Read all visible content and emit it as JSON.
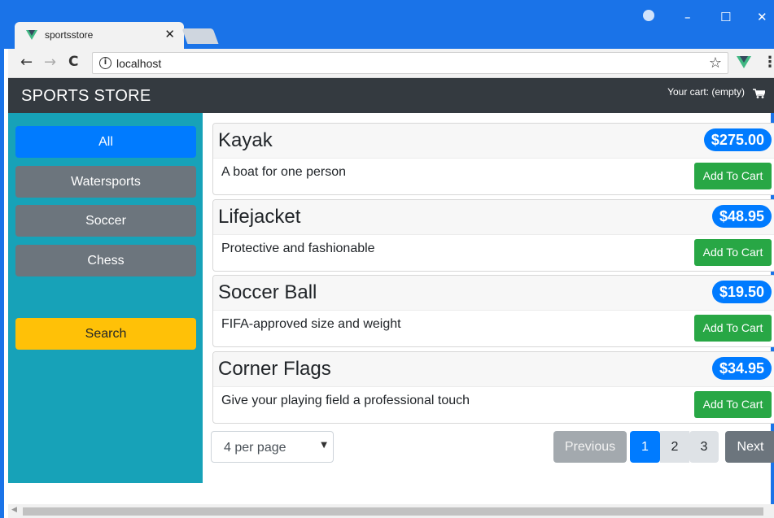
{
  "browser": {
    "tab_title": "sportsstore",
    "tab_close": "✕",
    "url": "localhost",
    "info_glyph": "i",
    "back_glyph": "←",
    "forward_glyph": "→",
    "reload_glyph": "C",
    "star_glyph": "☆",
    "menu_glyph": "⋮",
    "minimize_glyph": "–",
    "maximize_glyph": "☐",
    "close_glyph": "✕"
  },
  "app": {
    "brand": "SPORTS STORE",
    "cart_text": "Your cart: (empty)"
  },
  "sidebar": {
    "categories": [
      {
        "label": "All",
        "active": true
      },
      {
        "label": "Watersports",
        "active": false
      },
      {
        "label": "Soccer",
        "active": false
      },
      {
        "label": "Chess",
        "active": false
      }
    ],
    "search_label": "Search"
  },
  "products": [
    {
      "name": "Kayak",
      "price": "$275.00",
      "description": "A boat for one person",
      "button": "Add To Cart"
    },
    {
      "name": "Lifejacket",
      "price": "$48.95",
      "description": "Protective and fashionable",
      "button": "Add To Cart"
    },
    {
      "name": "Soccer Ball",
      "price": "$19.50",
      "description": "FIFA-approved size and weight",
      "button": "Add To Cart"
    },
    {
      "name": "Corner Flags",
      "price": "$34.95",
      "description": "Give your playing field a professional touch",
      "button": "Add To Cart"
    }
  ],
  "pagination": {
    "per_page": "4 per page",
    "previous": "Previous",
    "pages": [
      "1",
      "2",
      "3"
    ],
    "current_page": "1",
    "next": "Next"
  },
  "colors": {
    "chrome_blue": "#1a73e8",
    "navbar": "#343a40",
    "sidebar": "#17a2b8",
    "primary": "#007bff",
    "secondary": "#6c757d",
    "warning": "#ffc107",
    "success": "#28a745"
  }
}
